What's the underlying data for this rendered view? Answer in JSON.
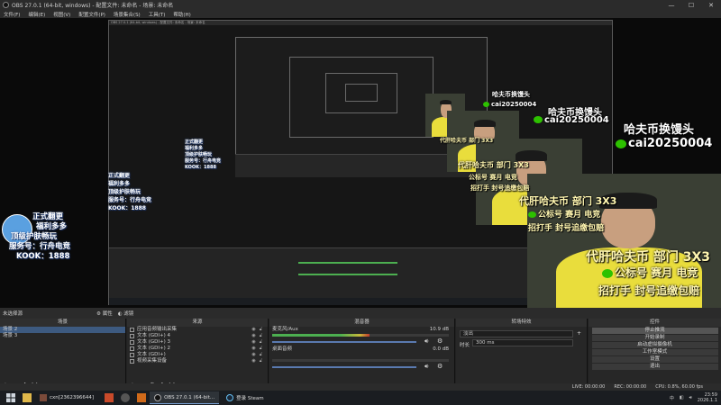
{
  "window": {
    "title": "OBS 27.0.1 (64-bit, windows) - 配置文件: 未命名 - 场景: 未命名",
    "buttons": [
      "—",
      "☐",
      "✕"
    ]
  },
  "menu": [
    "文件(F)",
    "编辑(E)",
    "视图(V)",
    "配置文件(P)",
    "场景集合(S)",
    "工具(T)",
    "帮助(H)"
  ],
  "nested_window": {
    "title": "OBS 27.0.1 (64-bit, windows) - 配置文件: 未命名 - 场景: 未命名"
  },
  "overlay": {
    "badge_lines": [
      "正式翻更",
      "福利多多",
      "顶级护肤畅玩",
      "服务号：行舟电竞",
      "KOOK：1888"
    ],
    "promo_big": {
      "top": "哈夫币换馒头",
      "wechat": "cai20250004",
      "line1": "代肝哈夫币 部门 3X3",
      "line2": "公标号 赛月 电竞",
      "line3": "招打手 封号追缴包赔"
    }
  },
  "dockbar": {
    "label": "未选择源",
    "properties": "属性",
    "filters": "滤镜"
  },
  "scenes": {
    "header": "场景",
    "items": [
      "场景 2",
      "场景 3"
    ]
  },
  "sources": {
    "header": "来源",
    "items": [
      "应用音频输出采集",
      "文本 (GDI+) 4",
      "文本 (GDI+) 3",
      "文本 (GDI+) 2",
      "文本 (GDI+)",
      "视频采集设备"
    ]
  },
  "mixer": {
    "header": "混音器",
    "tracks": [
      {
        "name": "麦克风/Aux",
        "db": "10.9 dB",
        "level": 0.55
      },
      {
        "name": "桌面音频",
        "db": "0.0 dB",
        "level": 0.0
      }
    ]
  },
  "transitions": {
    "header": "转场特效",
    "type": "淡出",
    "duration_label": "时长",
    "duration": "300 ms"
  },
  "controls": {
    "header": "控件",
    "buttons": [
      "停止推流",
      "开始录制",
      "启动虚拟摄像机",
      "工作室模式",
      "设置",
      "退出"
    ]
  },
  "status": {
    "live": "LIVE: 00:00:00",
    "rec": "REC: 00:00:00",
    "cpu": "CPU: 0.8%, 60.00 fps"
  },
  "taskbar": {
    "tasks": [
      "cxn[2362396644]",
      "OBS 27.0.1 (64-bit...",
      "登录 Steam"
    ],
    "time": "23:59",
    "date": "2026.1.1",
    "lang": "中"
  },
  "colors": {
    "accent": "#3d5a80",
    "meter_green": "#4caf50",
    "meter_yellow": "#c8b93a",
    "meter_red": "#c0392b",
    "wechat": "#2dc100"
  }
}
